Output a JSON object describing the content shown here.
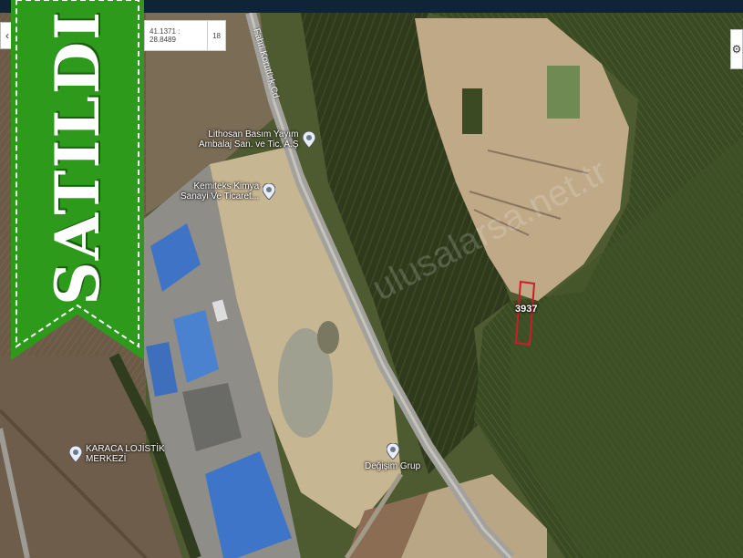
{
  "map": {
    "coordinates": "41.1371 : 28.8489",
    "zoom": "18",
    "road_label": "Fahri Korutürk Cd.",
    "parcel_label": "3937",
    "watermark": "ulusalarsa.net.tr",
    "pois": [
      {
        "label": "Lithosan Basım Yayım\nAmbalaj San. ve Tic. A.Ş"
      },
      {
        "label": "Kemiteks Kimya\nSanayi Ve Ticaret..."
      },
      {
        "label": "KARACA LOJİSTİK\nMERKEZİ"
      },
      {
        "label": "Değişim Grup"
      }
    ]
  },
  "banner": {
    "text": "SATILDI",
    "color": "#2e9a1c"
  },
  "controls": {
    "back_icon": "chevron-left-icon",
    "settings_icon": "gear-icon"
  },
  "colors": {
    "parcel_outline": "#d11a2a",
    "topbar": "#0f2436"
  }
}
